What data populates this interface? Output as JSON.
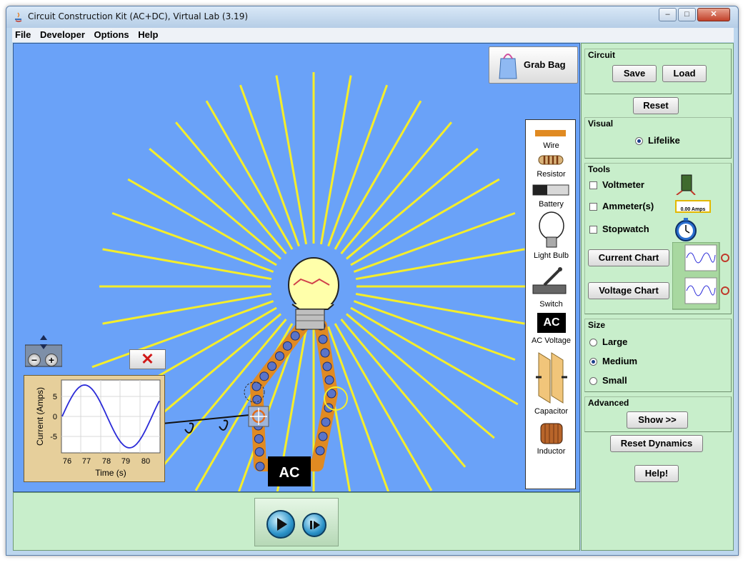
{
  "window": {
    "title": "Circuit Construction Kit (AC+DC), Virtual Lab (3.19)",
    "controls": {
      "minimize": "–",
      "maximize": "□",
      "close": "✕"
    }
  },
  "menu": {
    "items": [
      "File",
      "Developer",
      "Options",
      "Help"
    ]
  },
  "play_area": {
    "background_color": "#6aa2f8",
    "grab_bag_label": "Grab Bag",
    "toolbox": [
      {
        "name": "wire",
        "label": "Wire"
      },
      {
        "name": "resistor",
        "label": "Resistor"
      },
      {
        "name": "battery",
        "label": "Battery"
      },
      {
        "name": "light-bulb",
        "label": "Light Bulb"
      },
      {
        "name": "switch",
        "label": "Switch"
      },
      {
        "name": "ac-voltage",
        "label": "AC Voltage",
        "icon_text": "AC"
      },
      {
        "name": "capacitor",
        "label": "Capacitor"
      },
      {
        "name": "inductor",
        "label": "Inductor"
      }
    ],
    "ac_source_label": "AC"
  },
  "current_chart": {
    "zoom_minus": "−",
    "zoom_plus": "+",
    "close_label": "✕",
    "ylabel": "Current (Amps)",
    "xlabel": "Time (s)",
    "y_ticks": [
      "5",
      "0",
      "-5"
    ],
    "x_ticks": [
      "76",
      "77",
      "78",
      "79",
      "80"
    ]
  },
  "simulation": {
    "play_icon": "play-icon",
    "step_icon": "step-icon"
  },
  "control_panel": {
    "circuit": {
      "title": "Circuit",
      "save": "Save",
      "load": "Load"
    },
    "reset": "Reset",
    "visual": {
      "title": "Visual",
      "option": "Lifelike",
      "selected": true
    },
    "tools": {
      "title": "Tools",
      "voltmeter": "Voltmeter",
      "ammeter": "Ammeter(s)",
      "ammeter_readout": "0.00 Amps",
      "stopwatch": "Stopwatch",
      "current_chart": "Current Chart",
      "voltage_chart": "Voltage Chart"
    },
    "size": {
      "title": "Size",
      "options": [
        "Large",
        "Medium",
        "Small"
      ],
      "selected": "Medium"
    },
    "advanced": {
      "title": "Advanced",
      "show": "Show >>"
    },
    "reset_dynamics": "Reset Dynamics",
    "help": "Help!"
  }
}
